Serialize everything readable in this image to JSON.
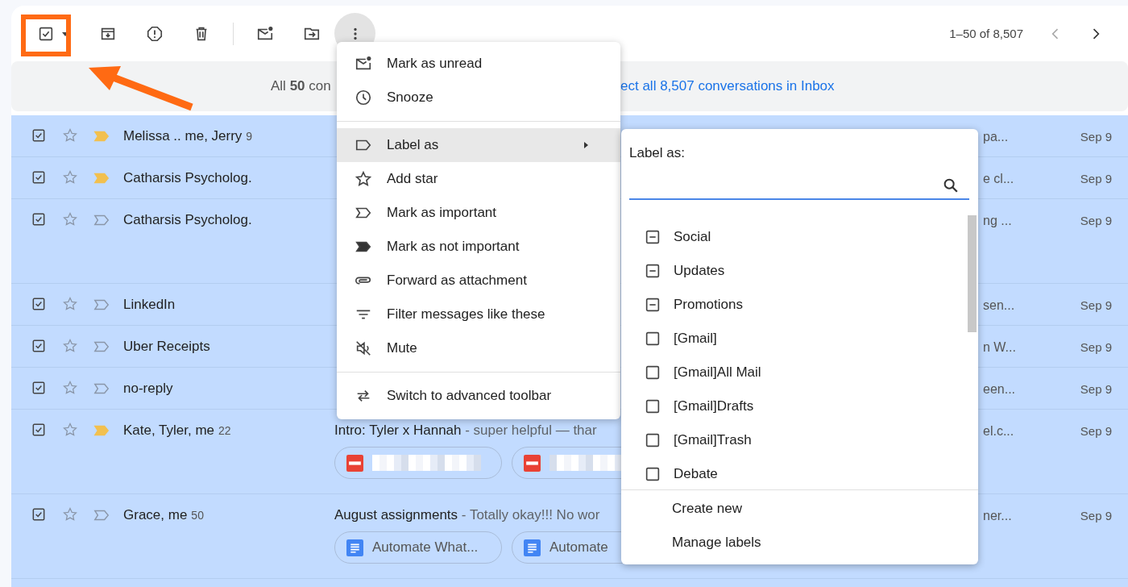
{
  "toolbar": {
    "select_all_checked": true,
    "pagination": "1–50 of 8,507"
  },
  "banner": {
    "text": "All **50** con",
    "link": "ect all 8,507 conversations in Inbox"
  },
  "rows": [
    {
      "selected": true,
      "starred": false,
      "important": true,
      "sender": "Melissa .. me, Jerry",
      "count": "9",
      "tail": "pa...",
      "date": "Sep 9",
      "kind": "plain"
    },
    {
      "selected": true,
      "starred": false,
      "important": true,
      "sender": "Catharsis Psycholog.",
      "tail": "e cl...",
      "date": "Sep 9",
      "kind": "plain"
    },
    {
      "selected": true,
      "starred": false,
      "important": false,
      "sender": "Catharsis Psycholog.",
      "tail": "ng ...",
      "date": "Sep 9",
      "kind": "tall"
    },
    {
      "selected": true,
      "starred": false,
      "important": false,
      "sender": "LinkedIn",
      "tail": "sen...",
      "date": "Sep 9",
      "kind": "plain"
    },
    {
      "selected": true,
      "starred": false,
      "important": false,
      "sender": "Uber Receipts",
      "tail": "n W...",
      "date": "Sep 9",
      "kind": "plain"
    },
    {
      "selected": true,
      "starred": false,
      "important": false,
      "sender": "no-reply",
      "tail": "een...",
      "date": "Sep 9",
      "kind": "plain"
    },
    {
      "selected": true,
      "starred": false,
      "important": true,
      "sender": "Kate, Tyler, me",
      "count": "22",
      "subject": "Intro: Tyler x Hannah",
      "snippet": " - super helpful — thar",
      "tail": "el.c...",
      "date": "Sep 9",
      "kind": "tall",
      "attachments": [
        {
          "kind": "pdf"
        },
        {
          "kind": "pdf"
        }
      ]
    },
    {
      "selected": true,
      "starred": false,
      "important": false,
      "sender": "Grace, me",
      "count": "50",
      "subject": "August assignments",
      "snippet": " - Totally okay!!! No wor",
      "tail": "ner...",
      "date": "Sep 9",
      "kind": "tall",
      "attachments": [
        {
          "kind": "doc",
          "name": "Automate What..."
        },
        {
          "kind": "doc",
          "name": "Automate"
        }
      ]
    }
  ],
  "menu": {
    "groups": [
      [
        {
          "kind": "mark-unread",
          "label": "Mark as unread",
          "selected": false
        },
        {
          "kind": "snooze",
          "label": "Snooze",
          "selected": false
        }
      ],
      [
        {
          "kind": "label",
          "label": "Label as",
          "selected": true,
          "submenu": true
        },
        {
          "kind": "star",
          "label": "Add star",
          "selected": false
        },
        {
          "kind": "important",
          "label": "Mark as important",
          "selected": false
        },
        {
          "kind": "not-important",
          "label": "Mark as not important",
          "selected": false
        },
        {
          "kind": "forward",
          "label": "Forward as attachment",
          "selected": false
        },
        {
          "kind": "filter",
          "label": "Filter messages like these",
          "selected": false
        },
        {
          "kind": "mute",
          "label": "Mute",
          "selected": false
        }
      ],
      [
        {
          "kind": "switch",
          "label": "Switch to advanced toolbar",
          "selected": false
        }
      ]
    ]
  },
  "label_menu": {
    "title": "Label as:",
    "labels": [
      {
        "name": "Social",
        "checked": false,
        "indeterminate": true
      },
      {
        "name": "Updates",
        "checked": false,
        "indeterminate": true
      },
      {
        "name": "Promotions",
        "checked": false,
        "indeterminate": true
      },
      {
        "name": "[Gmail]",
        "checked": false,
        "indeterminate": false
      },
      {
        "name": "[Gmail]All Mail",
        "checked": false,
        "indeterminate": false
      },
      {
        "name": "[Gmail]Drafts",
        "checked": false,
        "indeterminate": false
      },
      {
        "name": "[Gmail]Trash",
        "checked": false,
        "indeterminate": false
      },
      {
        "name": "Debate",
        "checked": false,
        "indeterminate": false
      }
    ],
    "actions": [
      "Create new",
      "Manage labels"
    ]
  }
}
